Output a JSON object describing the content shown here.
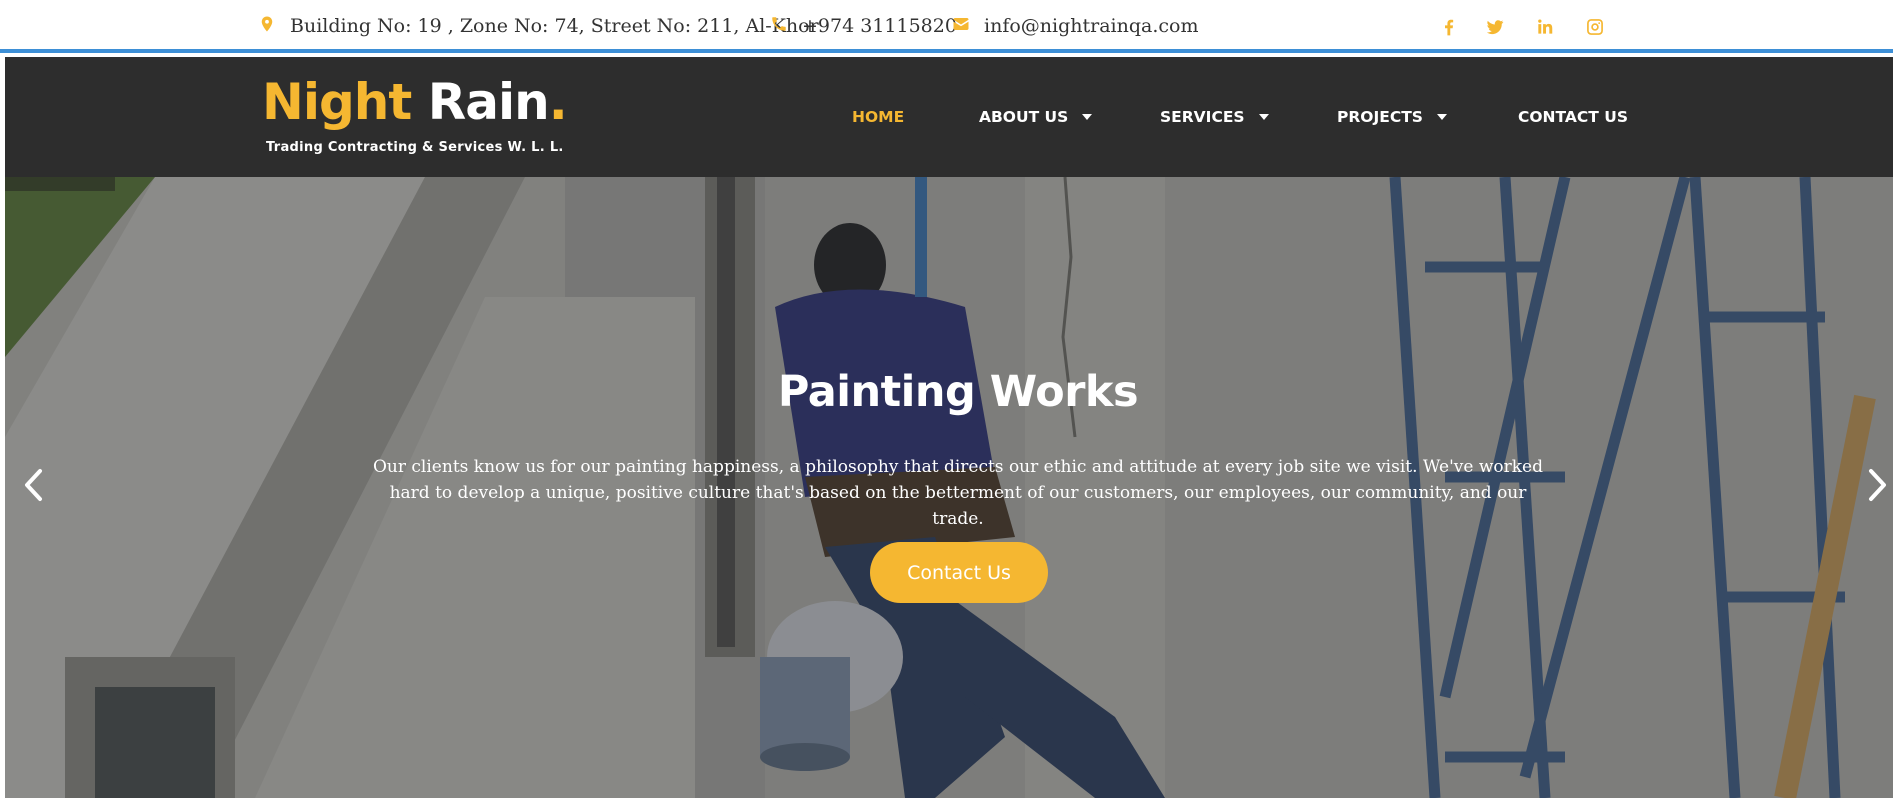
{
  "topbar": {
    "address": "Building No: 19 , Zone No: 74, Street No: 211, Al-Khor",
    "phone": "+974 31115820",
    "email": "info@nightrainqa.com",
    "social_icons": [
      "facebook-icon",
      "twitter-icon",
      "linkedin-icon",
      "instagram-icon"
    ]
  },
  "logo": {
    "word1": "Night",
    "word2": "Rain",
    "dot": ".",
    "tagline": "Trading Contracting & Services W. L. L."
  },
  "nav": {
    "home": "HOME",
    "about": "ABOUT US",
    "services": "SERVICES",
    "projects": "PROJECTS",
    "contact": "CONTACT US"
  },
  "hero": {
    "title": "Painting Works",
    "text": "Our clients know us for our painting happiness, a philosophy that directs our ethic and attitude at every job site we visit. We've worked hard to develop a unique, positive culture that's based on the betterment of our customers, our employees, our community, and our trade.",
    "button": "Contact Us"
  },
  "colors": {
    "accent": "#f5b731",
    "header_bg": "#2d2d2d",
    "topbar_border": "#3d8fd6"
  }
}
